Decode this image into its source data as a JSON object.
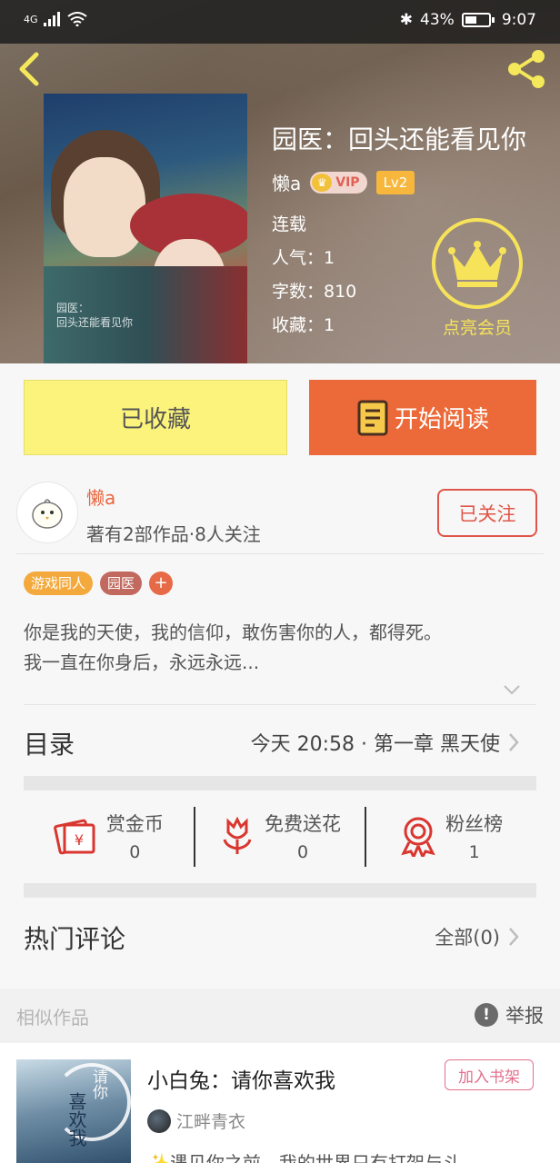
{
  "status_bar": {
    "network": "4G",
    "battery_percent": "43%",
    "time": "9:07"
  },
  "book": {
    "title": "园医：回头还能看见你",
    "author": "懒a",
    "vip_label": "VIP",
    "level": "Lv2",
    "status": "连载",
    "popularity": "人气：1",
    "word_count": "字数：810",
    "favorites": "收藏：1",
    "cover_text_line1": "园医：",
    "cover_text_line2": "回头还能看见你",
    "member_label": "点亮会员"
  },
  "actions": {
    "collected_label": "已收藏",
    "read_label": "开始阅读"
  },
  "author_card": {
    "name": "懒a",
    "stats": "著有2部作品·8人关注",
    "follow_label": "已关注"
  },
  "tags": [
    "游戏同人",
    "园医"
  ],
  "tag_add_label": "+",
  "intro": {
    "line1": "你是我的天使，我的信仰，敢伤害你的人，都得死。",
    "line2": "我一直在你身后，永远永远..."
  },
  "catalog": {
    "title": "目录",
    "latest": "今天 20:58 · 第一章  黑天使"
  },
  "rewards": [
    {
      "label": "赏金币",
      "count": "0",
      "icon": "coin-envelope-icon"
    },
    {
      "label": "免费送花",
      "count": "0",
      "icon": "flower-icon"
    },
    {
      "label": "粉丝榜",
      "count": "1",
      "icon": "medal-icon"
    }
  ],
  "comments": {
    "title": "热门评论",
    "all_label": "全部(0)"
  },
  "similar": {
    "title": "相似作品",
    "report_label": "举报",
    "item": {
      "title": "小白兔：请你喜欢我",
      "add_label": "加入书架",
      "author": "江畔青衣",
      "desc": "✨遇见你之前，我的世界只有打架与斗",
      "cover_text1": "请你",
      "cover_text2": "喜欢我"
    }
  },
  "colors": {
    "accent_orange": "#ec6a39",
    "collected_yellow": "#fbf37c",
    "member_yellow": "#f7e35a",
    "follow_red": "#e05548"
  }
}
